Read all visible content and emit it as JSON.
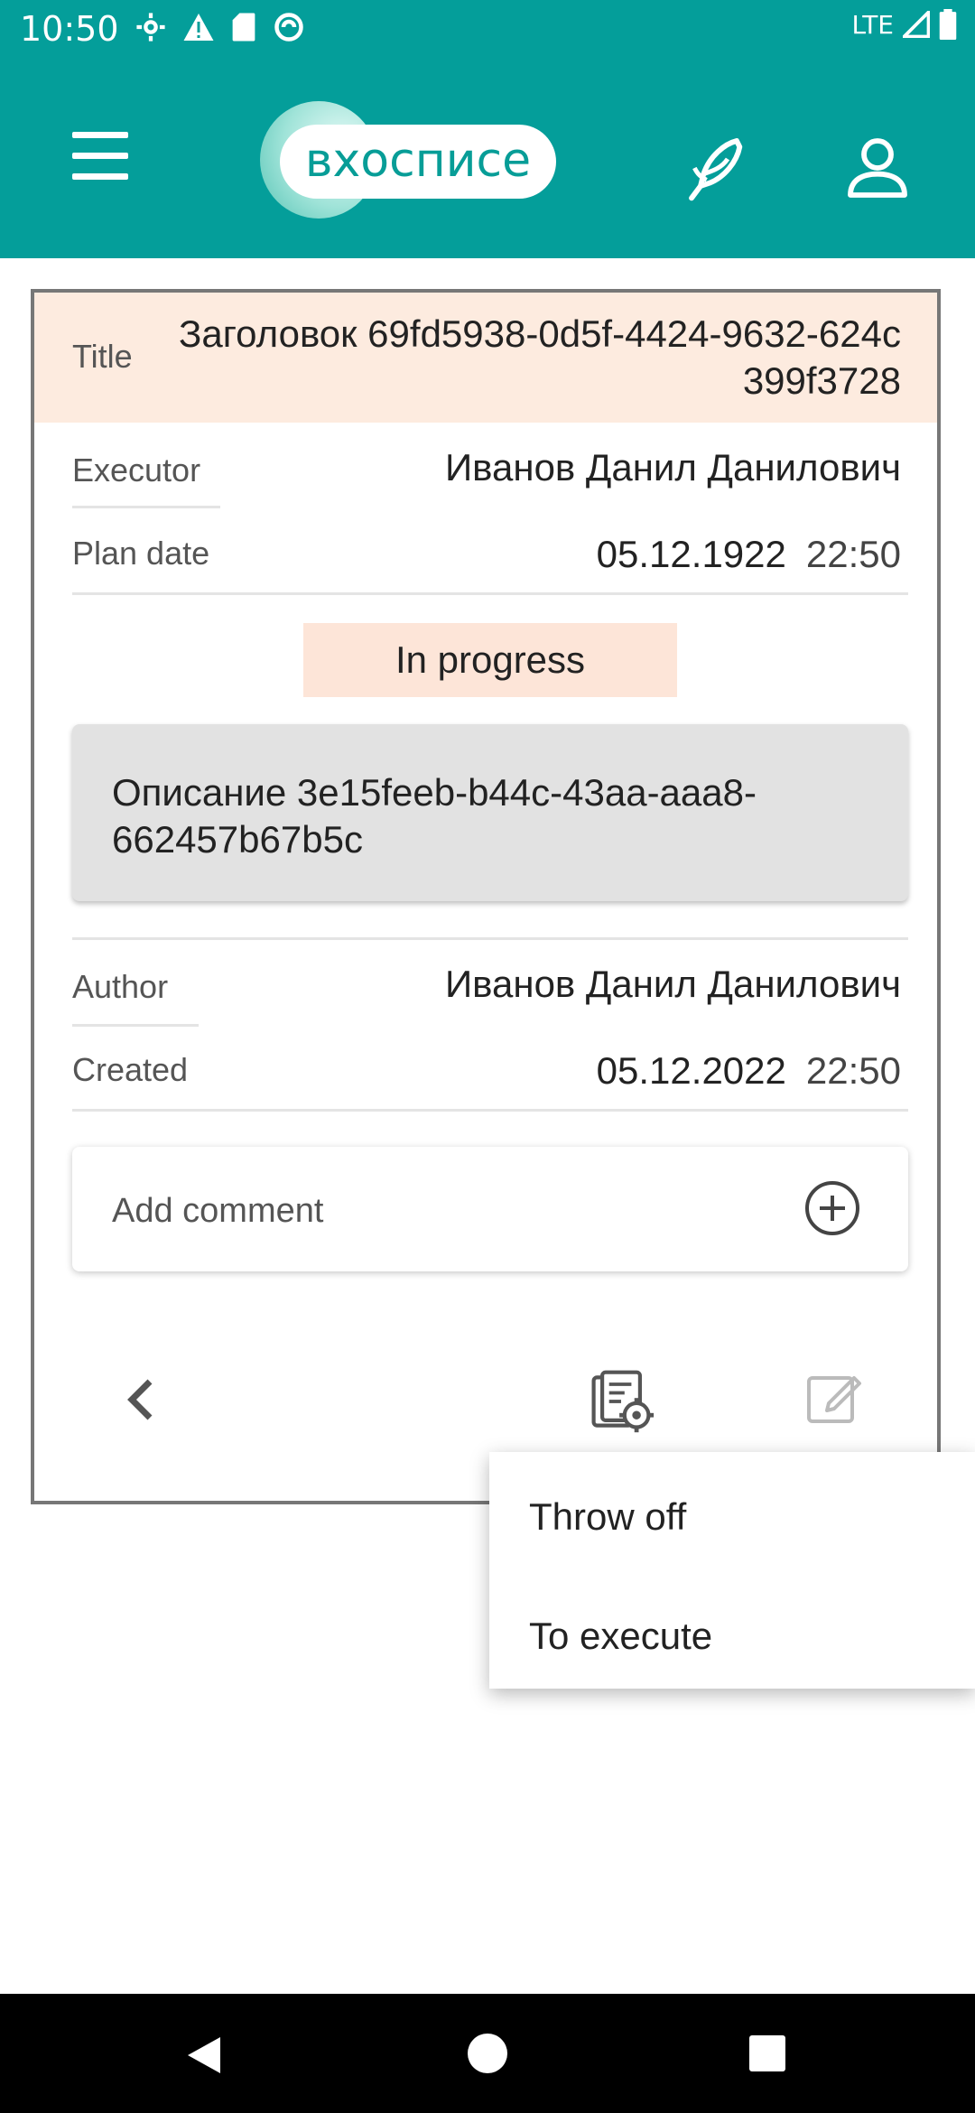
{
  "status_bar": {
    "time": "10:50",
    "network": "LTE",
    "icons": [
      "settings-icon",
      "warning-icon",
      "sd-card-icon",
      "sync-icon",
      "signal-icon",
      "battery-icon"
    ]
  },
  "app_bar": {
    "logo_text": "вхосписе",
    "icons": [
      "menu-icon",
      "feather-icon",
      "profile-icon"
    ]
  },
  "task": {
    "title_label": "Title",
    "title_value": "Заголовок 69fd5938-0d5f-4424-9632-624c399f3728",
    "executor_label": "Executor",
    "executor_value": "Иванов Данил Данилович",
    "plan_date_label": "Plan date",
    "plan_date": "05.12.1922",
    "plan_time": "22:50",
    "status": "In progress",
    "description": "Описание 3e15feeb-b44c-43aa-aaa8-662457b67b5c",
    "author_label": "Author",
    "author_value": "Иванов Данил Данилович",
    "created_label": "Created",
    "created_date": "05.12.2022",
    "created_time": "22:50"
  },
  "comment": {
    "placeholder": "Add comment"
  },
  "actions_menu": {
    "items": [
      "Throw off",
      "To execute"
    ]
  },
  "colors": {
    "primary": "#049e9a",
    "title_bg": "#fdebdf",
    "status_bg": "#fde5d8",
    "description_bg": "#e2e2e2"
  }
}
